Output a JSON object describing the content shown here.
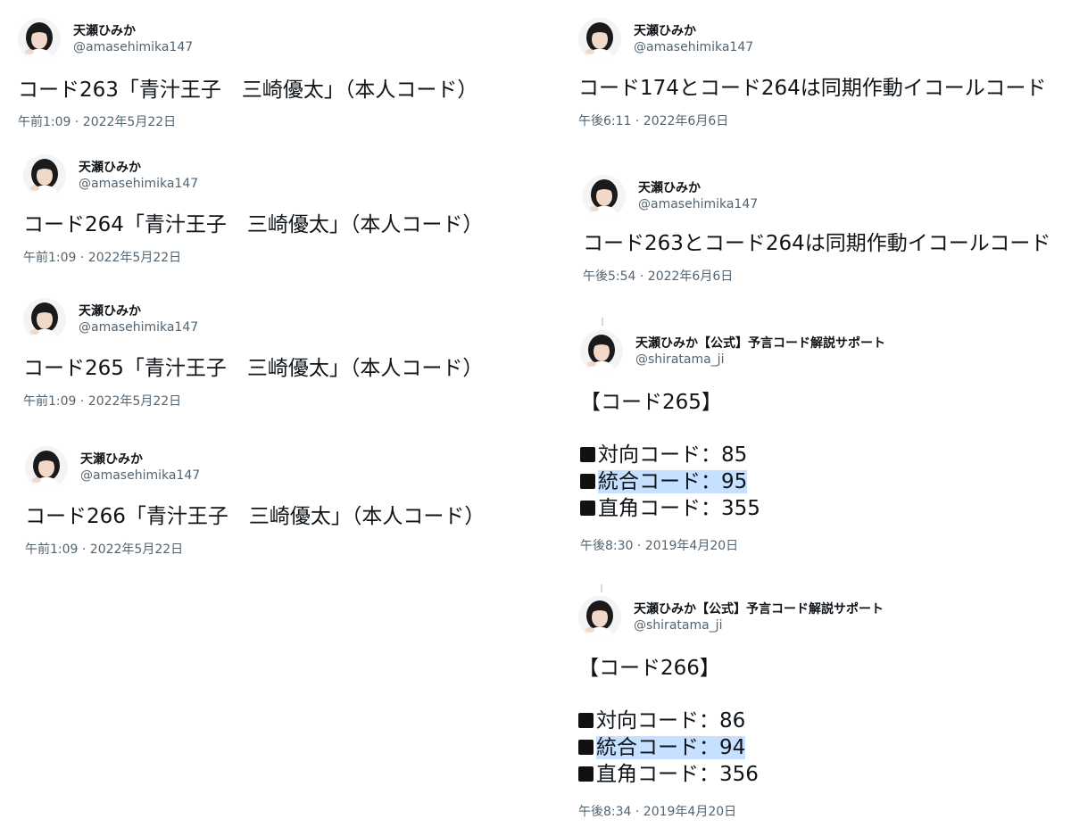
{
  "tweets": [
    {
      "name": "天瀬ひみか",
      "handle": "@amasehimika147",
      "text": "コード263「青汁王子　三崎優太」（本人コード）",
      "timestamp": "午前1:09 · 2022年5月22日"
    },
    {
      "name": "天瀬ひみか",
      "handle": "@amasehimika147",
      "text": "コード264「青汁王子　三崎優太」（本人コード）",
      "timestamp": "午前1:09 · 2022年5月22日"
    },
    {
      "name": "天瀬ひみか",
      "handle": "@amasehimika147",
      "text": "コード265「青汁王子　三崎優太」（本人コード）",
      "timestamp": "午前1:09 · 2022年5月22日"
    },
    {
      "name": "天瀬ひみか",
      "handle": "@amasehimika147",
      "text": "コード266「青汁王子　三崎優太」（本人コード）",
      "timestamp": "午前1:09 · 2022年5月22日"
    },
    {
      "name": "天瀬ひみか",
      "handle": "@amasehimika147",
      "text": "コード174とコード264は同期作動イコールコード",
      "timestamp": "午後6:11 · 2022年6月6日"
    },
    {
      "name": "天瀬ひみか",
      "handle": "@amasehimika147",
      "text": "コード263とコード264は同期作動イコールコード",
      "timestamp": "午後5:54 · 2022年6月6日"
    },
    {
      "name": "天瀬ひみか【公式】予言コード解説サポート",
      "handle": "@shiratama_ji",
      "title": "【コード265】",
      "items": [
        "対向コード：85",
        "統合コード：95",
        "直角コード：355"
      ],
      "timestamp": "午後8:30 · 2019年4月20日"
    },
    {
      "name": "天瀬ひみか【公式】予言コード解説サポート",
      "handle": "@shiratama_ji",
      "title": "【コード266】",
      "items": [
        "対向コード：86",
        "統合コード：94",
        "直角コード：356"
      ],
      "timestamp": "午後8:34 · 2019年4月20日"
    }
  ],
  "colors": {
    "text": "#0f1419",
    "secondary": "#536471",
    "highlight": "#c6e1ff"
  },
  "icons": {
    "avatar": "avatar-photo",
    "bullet": "black-square"
  }
}
